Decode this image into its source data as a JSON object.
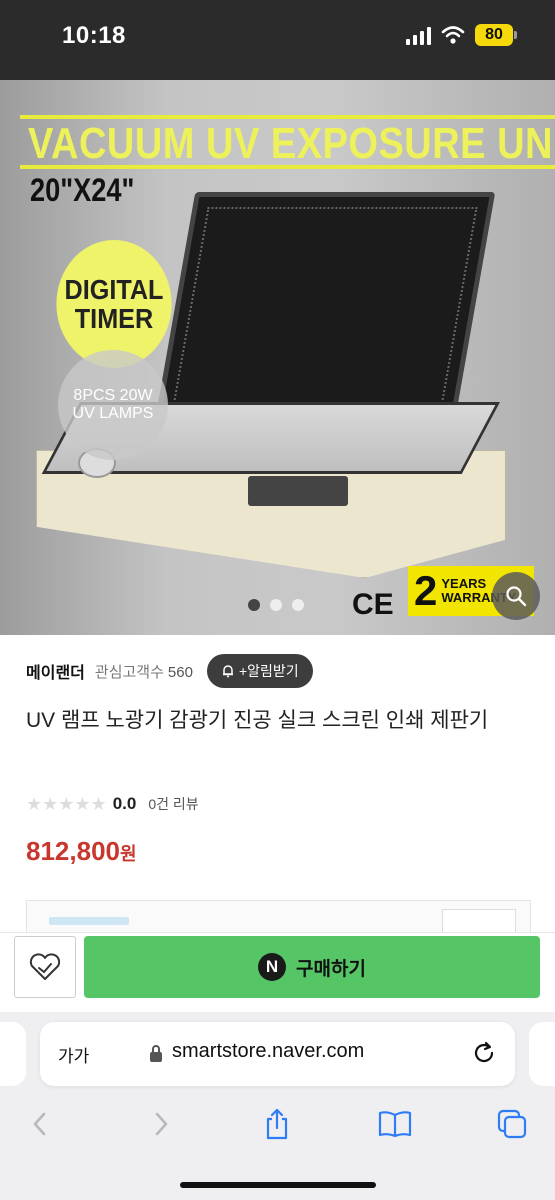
{
  "status_bar": {
    "time": "10:18",
    "battery": "80"
  },
  "product_image": {
    "headline": "VACUUM UV EXPOSURE UNIT",
    "size": "20\"X24\"",
    "badge_timer": [
      "DIGITAL",
      "TIMER"
    ],
    "badge_lamps": [
      "8PCS 20W",
      "UV LAMPS"
    ],
    "ce_mark": "CE",
    "warranty_number": "2",
    "warranty_text": [
      "YEARS",
      "WARRANTY"
    ],
    "carousel_total": 3,
    "carousel_active": 1,
    "icons": [
      "zoom-icon"
    ]
  },
  "store": {
    "name": "메이랜더",
    "followers_label": "관심고객수",
    "followers_count": "560",
    "notify_label": "+알림받기"
  },
  "product": {
    "title": "UV 램프 노광기 감광기 진공 실크 스크린 인쇄 제판기",
    "rating": "0.0",
    "review_count": "0건 리뷰",
    "price": "812,800",
    "price_unit": "원"
  },
  "purchase_bar": {
    "buy_label": "구매하기",
    "naver_badge": "N",
    "icons": [
      "heart-icon",
      "naver-n-icon"
    ]
  },
  "browser": {
    "text_size_label": "가가",
    "url": "smartstore.naver.com",
    "icons": [
      "lock-icon",
      "reload-icon",
      "back-icon",
      "forward-icon",
      "share-icon",
      "bookmarks-icon",
      "tabs-icon"
    ]
  },
  "colors": {
    "buy_green": "#55c566",
    "price_red": "#c8372d",
    "headline_yellow": "#eef25a"
  }
}
